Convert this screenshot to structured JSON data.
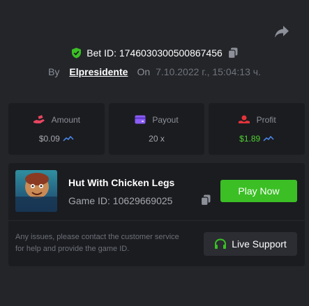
{
  "header": {
    "share_icon": "share-arrow-icon",
    "bet_id_text": "Bet ID: 1746030300500867456",
    "by_label": "By",
    "username": "Elpresidente",
    "on_label": "On",
    "date": "7.10.2022 г., 15:04:13 ч."
  },
  "stats": [
    {
      "label": "Amount",
      "value": "$0.09",
      "icon": "money-hand-icon",
      "color": "#e8455f"
    },
    {
      "label": "Payout",
      "value": "20 x",
      "icon": "wallet-icon",
      "color": "#8b5cf6"
    },
    {
      "label": "Profit",
      "value": "$1.89",
      "icon": "profit-hand-icon",
      "color": "#e5333b"
    }
  ],
  "game": {
    "thumb_text": "HUT WITH CHICKEN LEGS",
    "title": "Hut With Chicken Legs",
    "game_id_text": "Game ID: 10629669025",
    "play_label": "Play Now",
    "help_text": "Any issues, please contact the customer service for help and provide the game ID.",
    "support_label": "Live Support"
  },
  "colors": {
    "background": "#232529",
    "card": "#1b1c20",
    "play_button": "#3bbf25",
    "profit_text": "#4fd02f",
    "shield": "#3bbf25"
  }
}
